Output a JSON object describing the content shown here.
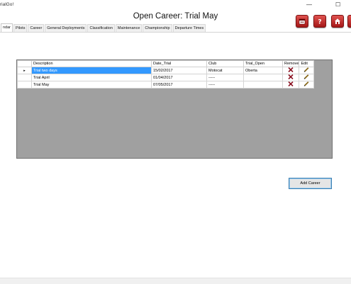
{
  "window": {
    "app_name": "rialGo!",
    "minimize_glyph": "—",
    "maximize_glyph": "☐"
  },
  "page_title": "Open Career: Trial May",
  "tabs": [
    {
      "label": "ndar",
      "active": true
    },
    {
      "label": "Pilots",
      "active": false
    },
    {
      "label": "Career",
      "active": false
    },
    {
      "label": "General Deployments",
      "active": false
    },
    {
      "label": "Classification",
      "active": false
    },
    {
      "label": "Maintenance",
      "active": false
    },
    {
      "label": "Championship",
      "active": false
    },
    {
      "label": "Departure Times",
      "active": false
    }
  ],
  "header_buttons": [
    {
      "name": "calendar-icon"
    },
    {
      "name": "help-icon"
    },
    {
      "name": "home-icon"
    },
    {
      "name": "exit-icon"
    }
  ],
  "grid": {
    "columns": [
      "Description",
      "Date_Trial",
      "Club",
      "Trial_Open",
      "Remove",
      "Edit"
    ],
    "row_indicator": "▸",
    "rows": [
      {
        "description": "Trial two days",
        "date": "15/02/2017",
        "club": "Motocat",
        "open": "Oberta",
        "selected": true
      },
      {
        "description": "Trial April",
        "date": "01/04/2017",
        "club": "-----",
        "open": "",
        "selected": false
      },
      {
        "description": "Trial May",
        "date": "07/05/2017",
        "club": "-----",
        "open": "",
        "selected": false
      }
    ]
  },
  "add_button_label": "Add Career",
  "colors": {
    "accent_red": "#b22020",
    "selection_blue": "#3399ff",
    "grid_background": "#a0a0a0"
  }
}
